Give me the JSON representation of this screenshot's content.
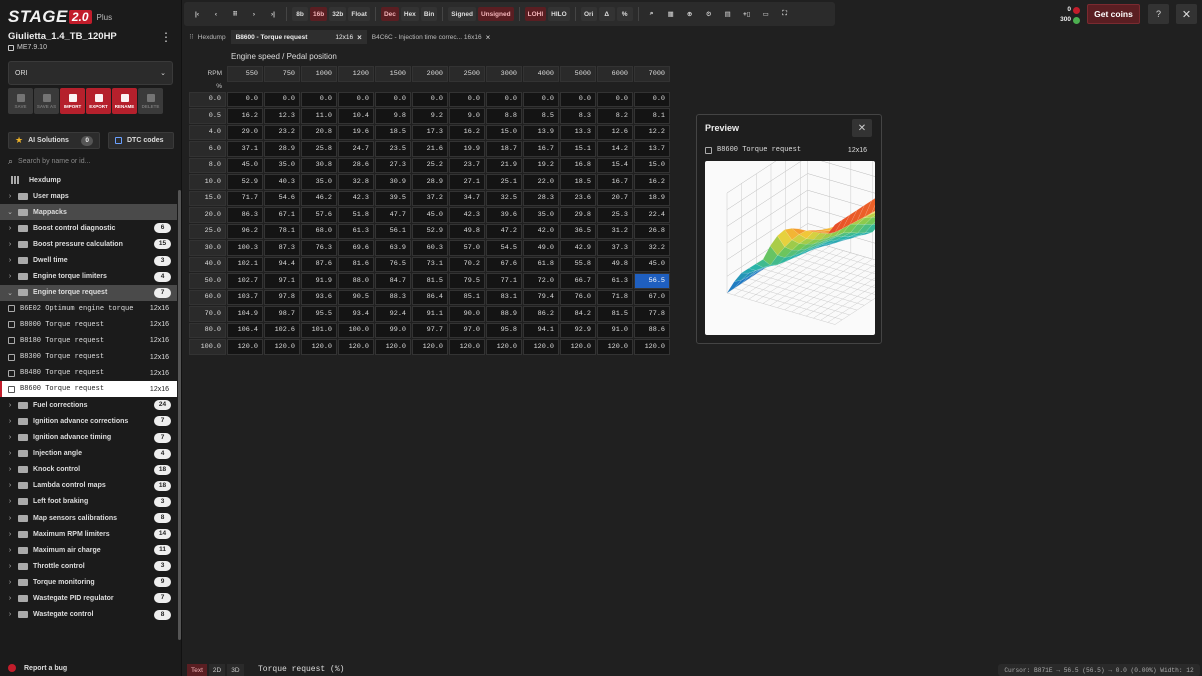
{
  "brand": {
    "name": "STAGE",
    "version_badge": "2.0",
    "plan": "Plus"
  },
  "project": {
    "name": "Giulietta_1.4_TB_120HP",
    "ecu": "ME7.9.10"
  },
  "version_select": {
    "value": "ORI"
  },
  "actions": [
    {
      "label": "SAVE",
      "enabled": false
    },
    {
      "label": "SAVE AS",
      "enabled": false
    },
    {
      "label": "IMPORT",
      "enabled": true
    },
    {
      "label": "EXPORT",
      "enabled": true
    },
    {
      "label": "RENAME",
      "enabled": true
    },
    {
      "label": "DELETE",
      "enabled": false
    }
  ],
  "ai_solutions": {
    "label": "AI Solutions",
    "count": "0"
  },
  "dtc": {
    "label": "DTC codes"
  },
  "search": {
    "placeholder": "Search by name or id..."
  },
  "tree": {
    "hexdump": "Hexdump",
    "user_maps": "User maps",
    "mappacks": "Mappacks",
    "groups_before": [
      {
        "label": "Boost control diagnostic",
        "count": "6"
      },
      {
        "label": "Boost pressure calculation",
        "count": "15"
      },
      {
        "label": "Dwell time",
        "count": "3"
      },
      {
        "label": "Engine torque limiters",
        "count": "4"
      }
    ],
    "open_group": {
      "label": "Engine torque request",
      "count": "7"
    },
    "open_items": [
      {
        "label": "B6E02 Optimum engine torque",
        "dim": "12x16"
      },
      {
        "label": "B8000 Torque request",
        "dim": "12x16"
      },
      {
        "label": "B8180 Torque request",
        "dim": "12x16"
      },
      {
        "label": "B8300 Torque request",
        "dim": "12x16"
      },
      {
        "label": "B8480 Torque request",
        "dim": "12x16"
      },
      {
        "label": "B8600 Torque request",
        "dim": "12x16"
      }
    ],
    "groups_after": [
      {
        "label": "Fuel corrections",
        "count": "24"
      },
      {
        "label": "Ignition advance corrections",
        "count": "7"
      },
      {
        "label": "Ignition advance timing",
        "count": "7"
      },
      {
        "label": "Injection angle",
        "count": "4"
      },
      {
        "label": "Knock control",
        "count": "18"
      },
      {
        "label": "Lambda control maps",
        "count": "18"
      },
      {
        "label": "Left foot braking",
        "count": "3"
      },
      {
        "label": "Map sensors calibrations",
        "count": "8"
      },
      {
        "label": "Maximum RPM limiters",
        "count": "14"
      },
      {
        "label": "Maximum air charge",
        "count": "11"
      },
      {
        "label": "Throttle control",
        "count": "3"
      },
      {
        "label": "Torque monitoring",
        "count": "9"
      },
      {
        "label": "Wastegate PID regulator",
        "count": "7"
      },
      {
        "label": "Wastegate control",
        "count": "8"
      }
    ]
  },
  "report_bug": "Report a bug",
  "toolbar": {
    "bits": [
      "8b",
      "16b",
      "32b",
      "Float"
    ],
    "base": [
      "Dec",
      "Hex",
      "Bin"
    ],
    "sign": [
      "Signed",
      "Unsigned"
    ],
    "order": [
      "LOHI",
      "HILO"
    ],
    "misc": [
      "Ori",
      "Δ",
      "%"
    ]
  },
  "coins": {
    "red": "0",
    "green": "300"
  },
  "get_coins": "Get coins",
  "help": "?",
  "tabs": [
    {
      "label": "Hexdump"
    },
    {
      "label": "B8600 - Torque request",
      "dim": "12x16"
    },
    {
      "label": "B4C6C - Injection time correc... 16x16"
    }
  ],
  "table": {
    "title": "Engine speed / Pedal position",
    "x_axis_label": "RPM",
    "y_axis_label": "%",
    "cols": [
      "550",
      "750",
      "1000",
      "1200",
      "1500",
      "2000",
      "2500",
      "3000",
      "4000",
      "5000",
      "6000",
      "7000"
    ],
    "rows": [
      {
        "h": "0.0",
        "v": [
          "0.0",
          "0.0",
          "0.0",
          "0.0",
          "0.0",
          "0.0",
          "0.0",
          "0.0",
          "0.0",
          "0.0",
          "0.0",
          "0.0"
        ]
      },
      {
        "h": "0.5",
        "v": [
          "16.2",
          "12.3",
          "11.0",
          "10.4",
          "9.8",
          "9.2",
          "9.0",
          "8.8",
          "8.5",
          "8.3",
          "8.2",
          "8.1"
        ]
      },
      {
        "h": "4.0",
        "v": [
          "29.0",
          "23.2",
          "20.8",
          "19.6",
          "18.5",
          "17.3",
          "16.2",
          "15.0",
          "13.9",
          "13.3",
          "12.6",
          "12.2"
        ]
      },
      {
        "h": "6.0",
        "v": [
          "37.1",
          "28.9",
          "25.8",
          "24.7",
          "23.5",
          "21.6",
          "19.9",
          "18.7",
          "16.7",
          "15.1",
          "14.2",
          "13.7"
        ]
      },
      {
        "h": "8.0",
        "v": [
          "45.0",
          "35.0",
          "30.8",
          "28.6",
          "27.3",
          "25.2",
          "23.7",
          "21.9",
          "19.2",
          "16.8",
          "15.4",
          "15.0"
        ]
      },
      {
        "h": "10.0",
        "v": [
          "52.9",
          "40.3",
          "35.0",
          "32.8",
          "30.9",
          "28.9",
          "27.1",
          "25.1",
          "22.0",
          "18.5",
          "16.7",
          "16.2"
        ]
      },
      {
        "h": "15.0",
        "v": [
          "71.7",
          "54.6",
          "46.2",
          "42.3",
          "39.5",
          "37.2",
          "34.7",
          "32.5",
          "28.3",
          "23.6",
          "20.7",
          "18.9"
        ]
      },
      {
        "h": "20.0",
        "v": [
          "86.3",
          "67.1",
          "57.6",
          "51.8",
          "47.7",
          "45.0",
          "42.3",
          "39.6",
          "35.0",
          "29.8",
          "25.3",
          "22.4"
        ]
      },
      {
        "h": "25.0",
        "v": [
          "96.2",
          "78.1",
          "68.0",
          "61.3",
          "56.1",
          "52.9",
          "49.8",
          "47.2",
          "42.0",
          "36.5",
          "31.2",
          "26.8"
        ]
      },
      {
        "h": "30.0",
        "v": [
          "100.3",
          "87.3",
          "76.3",
          "69.6",
          "63.9",
          "60.3",
          "57.0",
          "54.5",
          "49.0",
          "42.9",
          "37.3",
          "32.2"
        ]
      },
      {
        "h": "40.0",
        "v": [
          "102.1",
          "94.4",
          "87.6",
          "81.6",
          "76.5",
          "73.1",
          "70.2",
          "67.6",
          "61.8",
          "55.8",
          "49.8",
          "45.0"
        ]
      },
      {
        "h": "50.0",
        "v": [
          "102.7",
          "97.1",
          "91.9",
          "88.0",
          "84.7",
          "81.5",
          "79.5",
          "77.1",
          "72.0",
          "66.7",
          "61.3",
          "56.5"
        ]
      },
      {
        "h": "60.0",
        "v": [
          "103.7",
          "97.8",
          "93.6",
          "90.5",
          "88.3",
          "86.4",
          "85.1",
          "83.1",
          "79.4",
          "76.0",
          "71.8",
          "67.0"
        ]
      },
      {
        "h": "70.0",
        "v": [
          "104.9",
          "98.7",
          "95.5",
          "93.4",
          "92.4",
          "91.1",
          "90.0",
          "88.9",
          "86.2",
          "84.2",
          "81.5",
          "77.8"
        ]
      },
      {
        "h": "80.0",
        "v": [
          "106.4",
          "102.6",
          "101.0",
          "100.0",
          "99.0",
          "97.7",
          "97.0",
          "95.8",
          "94.1",
          "92.9",
          "91.0",
          "88.6"
        ]
      },
      {
        "h": "100.0",
        "v": [
          "120.0",
          "120.0",
          "120.0",
          "120.0",
          "120.0",
          "120.0",
          "120.0",
          "120.0",
          "120.0",
          "120.0",
          "120.0",
          "120.0"
        ]
      }
    ],
    "selected": {
      "row": 11,
      "col": 11
    }
  },
  "preview": {
    "title": "Preview",
    "map": "B8600 Torque request",
    "dim": "12x16"
  },
  "view_modes": [
    "Text",
    "2D",
    "3D"
  ],
  "bottom_title": "Torque request (%)",
  "status": "Cursor: B871E → 56.5 (56.5) → 0.0 (0.00%) Width: 12"
}
